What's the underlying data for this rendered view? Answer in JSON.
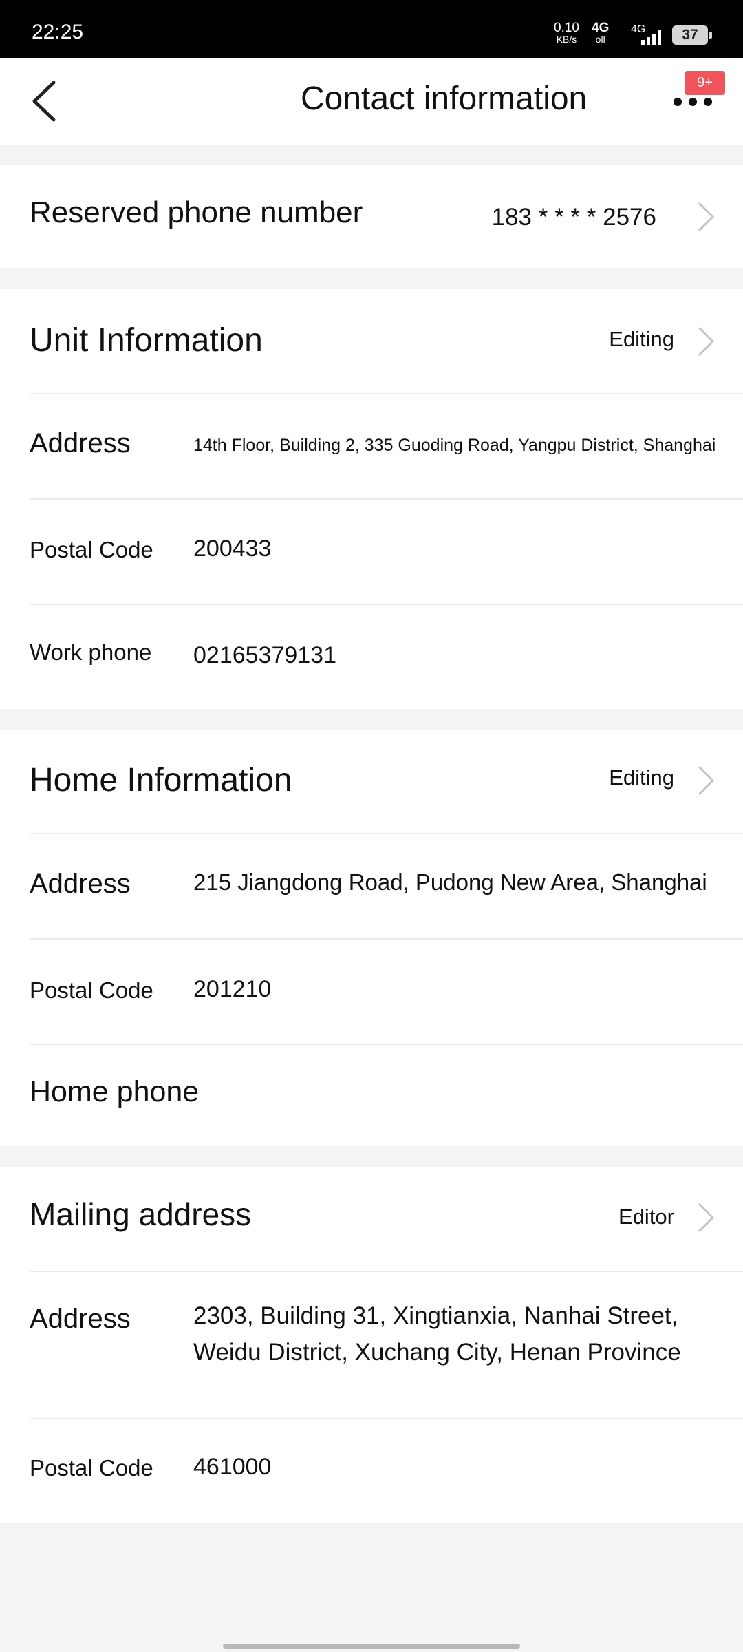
{
  "status_bar": {
    "time": "22:25",
    "net_speed": "0.10",
    "net_unit": "KB/s",
    "net1": "4G",
    "net1_sub": "oll",
    "net2": "4G",
    "battery": "37"
  },
  "header": {
    "title": "Contact information",
    "badge": "9+"
  },
  "reserved": {
    "label": "Reserved phone number",
    "value": "183 * * * * 2576"
  },
  "unit": {
    "title": "Unit Information",
    "edit_label": "Editing",
    "address_label": "Address",
    "address_value": "14th Floor, Building 2, 335 Guoding Road, Yangpu District, Shanghai",
    "postal_label": "Postal Code",
    "postal_value": "200433",
    "phone_label": "Work phone",
    "phone_value": "02165379131"
  },
  "home": {
    "title": "Home Information",
    "edit_label": "Editing",
    "address_label": "Address",
    "address_value": "215 Jiangdong Road, Pudong New Area, Shanghai",
    "postal_label": "Postal Code",
    "postal_value": "201210",
    "phone_label": "Home phone"
  },
  "mailing": {
    "title": "Mailing address",
    "edit_label": "Editor",
    "address_label": "Address",
    "address_line1": "2303, Building 31, Xingtianxia, Nanhai Street,",
    "address_line2": "Weidu District, Xuchang City, Henan Province",
    "postal_label": "Postal Code",
    "postal_value": "461000"
  }
}
